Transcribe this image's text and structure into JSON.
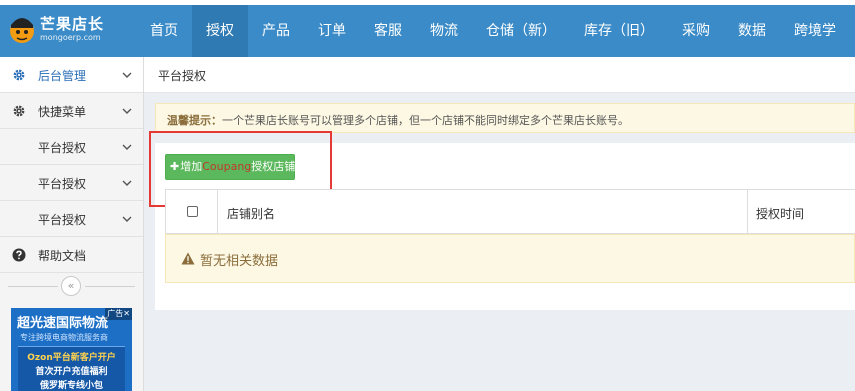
{
  "brand": {
    "title": "芒果店长",
    "subtitle": "mongoerp.com"
  },
  "nav": {
    "items": [
      "首页",
      "授权",
      "产品",
      "订单",
      "客服",
      "物流",
      "仓储（新）",
      "库存（旧）",
      "采购",
      "数据",
      "跨境学"
    ],
    "active": "授权"
  },
  "sidebar": {
    "items": [
      {
        "label": "后台管理",
        "icon": "gear-icon"
      },
      {
        "label": "快捷菜单",
        "icon": "cog-icon"
      },
      {
        "label": "平台授权",
        "icon": ""
      },
      {
        "label": "平台授权",
        "icon": ""
      },
      {
        "label": "平台授权",
        "icon": ""
      },
      {
        "label": "帮助文档",
        "icon": "question-circle-icon"
      }
    ],
    "collapse_glyph": "«"
  },
  "ad": {
    "title": "超光速国际物流",
    "subtitle": "专注跨境电商物流服务商",
    "line1": "Ozon平台新客户开户",
    "line2": "首次开户充值福利",
    "line3": "俄罗斯专线小包",
    "tag": "广告✕"
  },
  "breadcrumb": "平台授权",
  "tip": {
    "label": "温馨提示：",
    "text": "一个芒果店长账号可以管理多个店铺，但一个店铺不能同时绑定多个芒果店长账号。"
  },
  "add_button": {
    "prefix": "增加",
    "platform": "Coupang",
    "suffix": "授权店铺"
  },
  "table": {
    "columns": [
      "店铺别名",
      "授权时间"
    ],
    "empty_text": "暂无相关数据"
  },
  "colors": {
    "header": "#3a8bc7",
    "header_active": "#2f7ab3",
    "button_green": "#5cb85c",
    "highlight_red": "#e53935",
    "tip_bg": "#fcf8e3"
  }
}
